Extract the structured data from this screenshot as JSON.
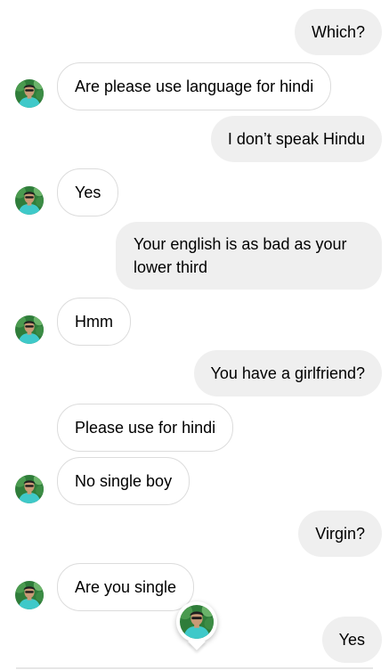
{
  "messages": [
    {
      "side": "out",
      "text": "Which?"
    },
    {
      "side": "in",
      "text": "Are please use language for hindi"
    },
    {
      "side": "out",
      "text": "I don’t speak Hindu"
    },
    {
      "side": "in",
      "text": "Yes"
    },
    {
      "side": "out",
      "text": "Your english is as bad as your lower third"
    },
    {
      "side": "in",
      "text": "Hmm"
    },
    {
      "side": "out",
      "text": "You have a girlfriend?"
    },
    {
      "side": "in",
      "text": "Please use for hindi"
    },
    {
      "side": "in",
      "text": "No single boy"
    },
    {
      "side": "out",
      "text": "Virgin?"
    },
    {
      "side": "in",
      "text": "Are you single"
    },
    {
      "side": "out",
      "text": "Yes"
    }
  ],
  "colors": {
    "outgoing_bubble": "#efefef",
    "incoming_border": "#dcdcdc",
    "avatar_shirt": "#3fc9c9",
    "avatar_foliage": "#2f7d3a"
  },
  "icons": {
    "avatar": "contact-avatar",
    "seen_indicator": "seen-avatar-icon"
  }
}
